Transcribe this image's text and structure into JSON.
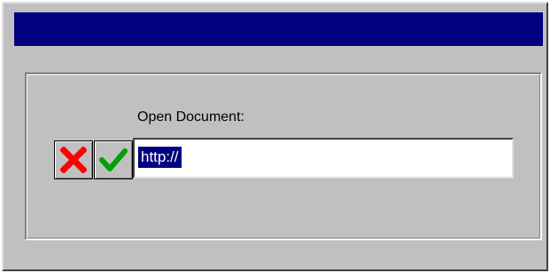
{
  "window": {
    "title": ""
  },
  "dialog": {
    "label": "Open Document:",
    "url_value": "http://",
    "cancel_icon": "cancel-x-icon",
    "ok_icon": "ok-checkmark-icon"
  },
  "colors": {
    "titlebar": "#000080",
    "face": "#c0c0c0",
    "cancel_icon": "#ff0000",
    "ok_icon": "#00a000",
    "selection": "#000080"
  }
}
